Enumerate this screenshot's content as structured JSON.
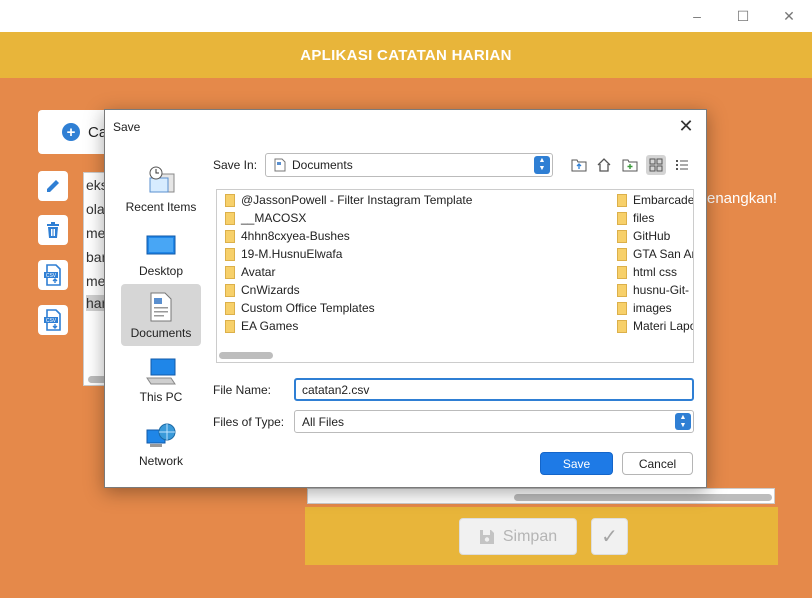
{
  "app": {
    "title": "APLIKASI CATATAN HARIAN",
    "add_label": "Ca",
    "notes_lines": [
      "eks",
      "ola",
      "me",
      "bar",
      "me",
      "har"
    ],
    "partial_text": "enangkan!",
    "simpan_label": "Simpan",
    "colors": {
      "header": "#e8b53a",
      "body": "#e5894a",
      "accent": "#2f7fd4"
    }
  },
  "window_controls": {
    "minimize": "–",
    "maximize": "☐",
    "close": "✕"
  },
  "dialog": {
    "title": "Save",
    "close_glyph": "✕",
    "places": [
      {
        "label": "Recent Items",
        "icon": "recent-items-icon"
      },
      {
        "label": "Desktop",
        "icon": "desktop-icon"
      },
      {
        "label": "Documents",
        "icon": "documents-icon"
      },
      {
        "label": "This PC",
        "icon": "this-pc-icon"
      },
      {
        "label": "Network",
        "icon": "network-icon"
      }
    ],
    "save_in_label": "Save In:",
    "save_in_value": "Documents",
    "files_col1": [
      "@JassonPowell - Filter Instagram Template",
      "__MACOSX",
      "4hhn8cxyea-Bushes",
      "19-M.HusnuElwafa",
      "Avatar",
      "CnWizards",
      "Custom Office Templates",
      "EA Games"
    ],
    "files_col2": [
      "Embarcade",
      "files",
      "GitHub",
      "GTA San Ar",
      "html css",
      "husnu-Git-",
      "images",
      "Materi Lapo"
    ],
    "file_name_label": "File Name:",
    "file_name_value": "catatan2.csv",
    "file_type_label": "Files of Type:",
    "file_type_value": "All Files",
    "save_label": "Save",
    "cancel_label": "Cancel"
  }
}
